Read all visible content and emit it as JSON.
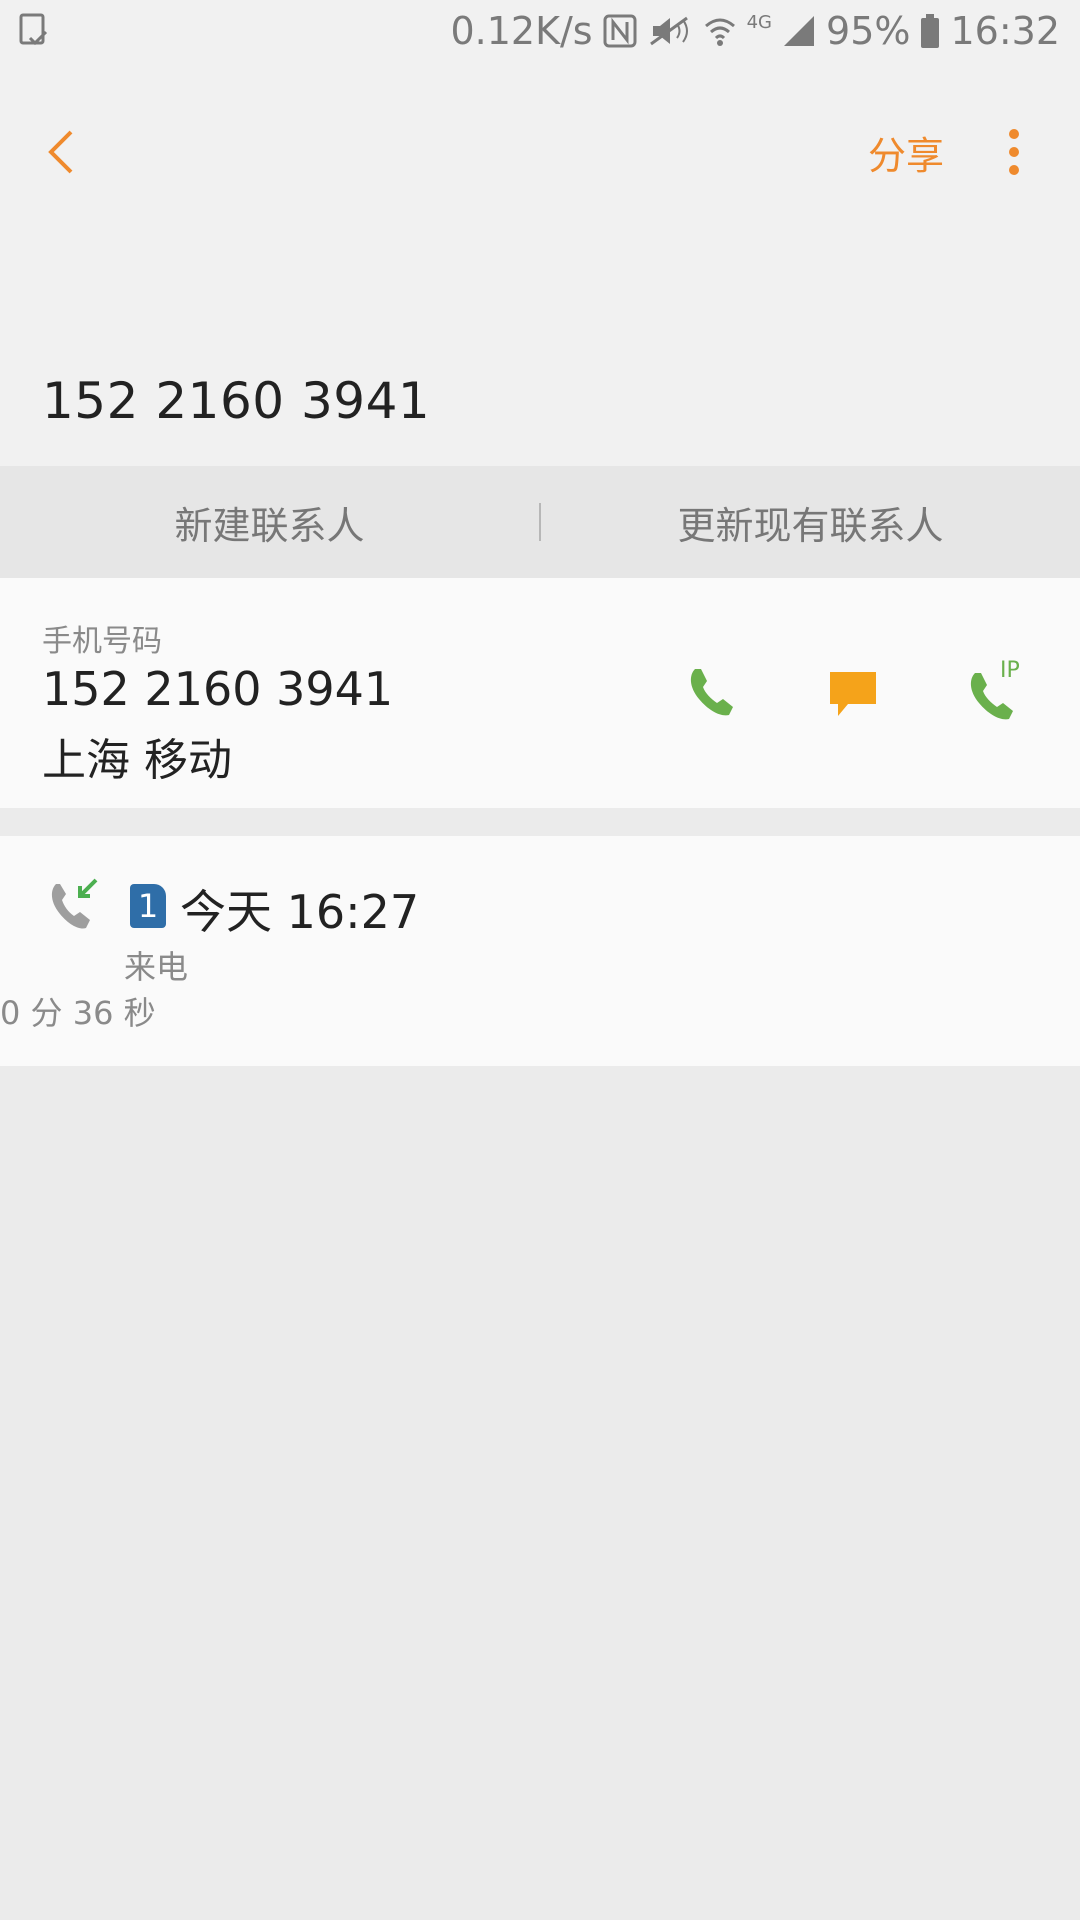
{
  "status_bar": {
    "speed": "0.12K/s",
    "network": "4G",
    "battery": "95%",
    "time": "16:32"
  },
  "header": {
    "share_label": "分享",
    "title": "152 2160 3941"
  },
  "actions": {
    "new_contact": "新建联系人",
    "update_contact": "更新现有联系人"
  },
  "phone_card": {
    "label": "手机号码",
    "number": "152 2160 3941",
    "carrier": "上海 移动",
    "ip_label": "IP"
  },
  "call_log": {
    "sim": "1",
    "time": "今天 16:27",
    "type": "来电",
    "duration": "0 分 36 秒"
  },
  "colors": {
    "accent": "#ef8a2d",
    "call_green": "#6ab04c",
    "message_orange": "#f5a31a",
    "sim_blue": "#2f6ea8"
  }
}
